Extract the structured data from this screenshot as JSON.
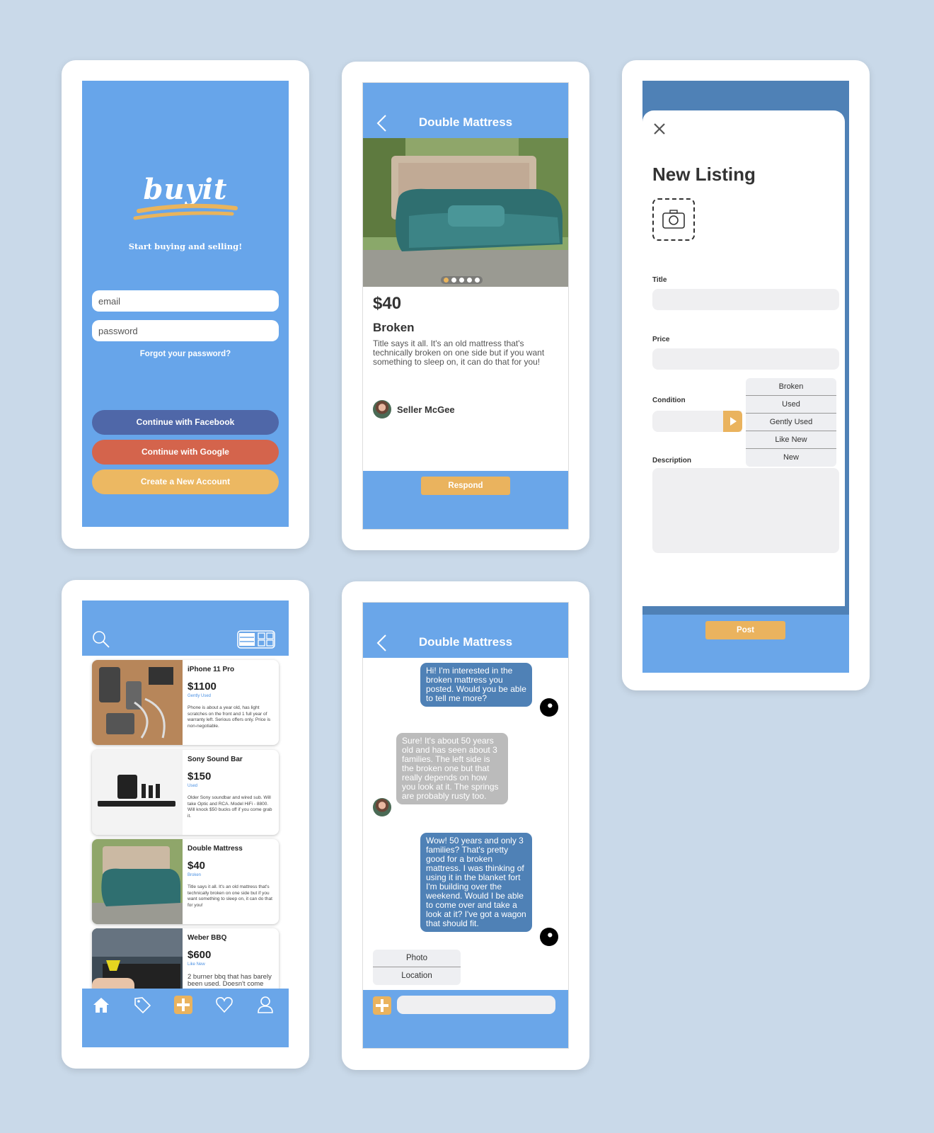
{
  "login": {
    "logo": "buyit",
    "tagline": "Start buying and selling!",
    "email_placeholder": "email",
    "password_placeholder": "password",
    "forgot": "Forgot your password?",
    "facebook": "Continue with Facebook",
    "google": "Continue with Google",
    "create": "Create a New Account"
  },
  "detail": {
    "title": "Double Mattress",
    "price": "$40",
    "condition": "Broken",
    "description": "Title says it all. It's an old mattress that's technically broken on one side but if you want something to sleep on, it can do that for you!",
    "seller": "Seller McGee",
    "respond": "Respond",
    "carousel_count": 5,
    "carousel_active": 1
  },
  "new_listing": {
    "title": "New Listing",
    "title_label": "Title",
    "price_label": "Price",
    "condition_label": "Condition",
    "description_label": "Description",
    "condition_options": [
      "Broken",
      "Used",
      "Gently Used",
      "Like New",
      "New"
    ],
    "post": "Post"
  },
  "list": {
    "items": [
      {
        "title": "iPhone 11 Pro",
        "price": "$1100",
        "condition": "Gently Used",
        "description": "Phone is about a year old, has light scratches on the front and 1 full year of warranty left. Serious offers only. Price is non-negotiable."
      },
      {
        "title": "Sony Sound Bar",
        "price": "$150",
        "condition": "Used",
        "description": "Older Sony soundbar and wired sub. Will take Optic and RCA. Model HiFi - 8800. Will knock $50 bucks off if you come grab it."
      },
      {
        "title": "Double Mattress",
        "price": "$40",
        "condition": "Broken",
        "description": "Title says it all. It's an old mattress that's technically broken on one side but if you want something to sleep on, it can do that for you!"
      },
      {
        "title": "Weber BBQ",
        "price": "$600",
        "condition": "Like New",
        "description": "2 burner bbq that has barely been used. Doesn't come"
      }
    ],
    "nav": [
      "home-icon",
      "tag-icon",
      "plus-icon",
      "heart-icon",
      "profile-icon"
    ]
  },
  "chat": {
    "title": "Double Mattress",
    "messages": [
      {
        "from": "me",
        "text": "Hi! I'm interested in the broken mattress you posted. Would you be able to tell me more?"
      },
      {
        "from": "them",
        "text": "Sure! It's about 50 years old and has seen about 3 families. The left side is the broken one but that really depends on how you look at it. The springs are probably rusty too."
      },
      {
        "from": "me",
        "text": "Wow! 50 years and only 3 families? That's pretty good for a broken mattress. I was thinking of using it in the blanket fort I'm building over the weekend. Would I be able to come over and take a look at it? I've got a wagon that should fit."
      }
    ],
    "attach_options": [
      "Photo",
      "Location"
    ],
    "input_placeholder": ""
  },
  "colors": {
    "primary_blue": "#6aa6e9",
    "dark_blue": "#4f81b6",
    "accent_orange": "#eab35e",
    "facebook": "#4f67a8",
    "google": "#d4644c"
  }
}
